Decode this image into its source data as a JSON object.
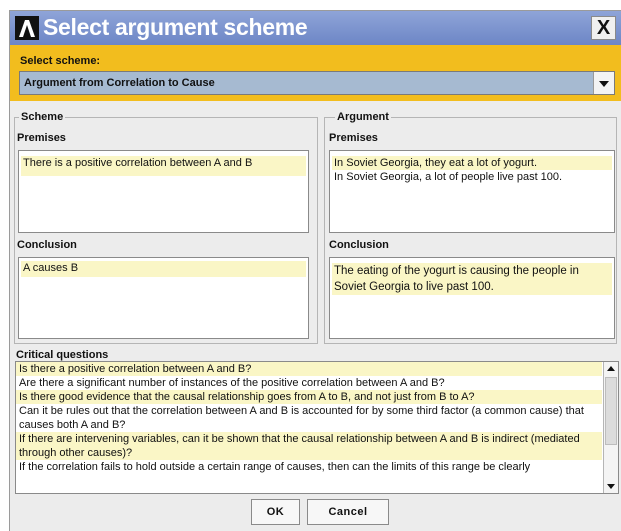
{
  "window": {
    "title": "Select argument scheme",
    "close_label": "X"
  },
  "scheme_selector": {
    "label": "Select scheme:",
    "selected": "Argument from Correlation to Cause"
  },
  "scheme_panel": {
    "title": "Scheme",
    "premises_label": "Premises",
    "premises": [
      "There is a positive correlation between A and B"
    ],
    "conclusion_label": "Conclusion",
    "conclusion": [
      "A causes B"
    ]
  },
  "argument_panel": {
    "title": "Argument",
    "premises_label": "Premises",
    "premises": [
      "In Soviet Georgia, they eat a lot of yogurt.",
      "In Soviet Georgia, a lot of people live past 100."
    ],
    "conclusion_label": "Conclusion",
    "conclusion": [
      "The eating of the yogurt is causing the people in",
      "Soviet Georgia to live past 100."
    ]
  },
  "critical_questions": {
    "label": "Critical questions",
    "items": [
      "Is there a positive correlation between A and B?",
      "Are there a significant number of instances of the positive correlation between A and B?",
      "Is there good evidence that the causal relationship goes from A to B, and not just from B to A?",
      "Can it be rules out that the correlation between A and B is accounted for by some third factor (a common cause) that causes both A and B?",
      "If there are intervening variables, can it be shown that the causal relationship between A and B is indirect (mediated through other causes)?",
      "If the correlation fails to hold outside a certain range of causes, then can the limits of this range be clearly"
    ]
  },
  "buttons": {
    "ok": "OK",
    "cancel": "Cancel"
  },
  "colors": {
    "title_bar": "#7d95cf",
    "scheme_bar": "#f2bd1e",
    "select_fill": "#a6bad1",
    "highlight": "#faf6c6",
    "dialog_bg": "#ececec"
  }
}
